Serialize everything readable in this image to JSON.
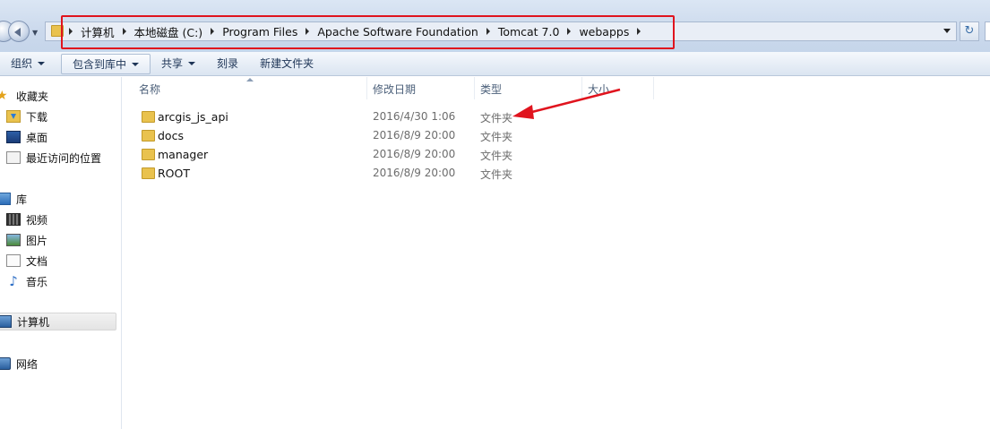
{
  "address_bar": {
    "crumbs": [
      "计算机",
      "本地磁盘 (C:)",
      "Program Files",
      "Apache Software Foundation",
      "Tomcat 7.0",
      "webapps"
    ]
  },
  "toolbar": {
    "organize": "组织",
    "include_in_library": "包含到库中",
    "share": "共享",
    "burn": "刻录",
    "new_folder": "新建文件夹"
  },
  "nav": {
    "favorites": "收藏夹",
    "downloads": "下载",
    "desktop": "桌面",
    "recent": "最近访问的位置",
    "libraries": "库",
    "videos": "视频",
    "pictures": "图片",
    "documents": "文档",
    "music": "音乐",
    "computer": "计算机",
    "network": "网络"
  },
  "columns": {
    "name": "名称",
    "date": "修改日期",
    "type": "类型",
    "size": "大小"
  },
  "files": [
    {
      "name": "arcgis_js_api",
      "date": "2016/4/30 1:06",
      "type": "文件夹"
    },
    {
      "name": "docs",
      "date": "2016/8/9 20:00",
      "type": "文件夹"
    },
    {
      "name": "manager",
      "date": "2016/8/9 20:00",
      "type": "文件夹"
    },
    {
      "name": "ROOT",
      "date": "2016/8/9 20:00",
      "type": "文件夹"
    }
  ],
  "colors": {
    "annotation": "#e0141e"
  }
}
